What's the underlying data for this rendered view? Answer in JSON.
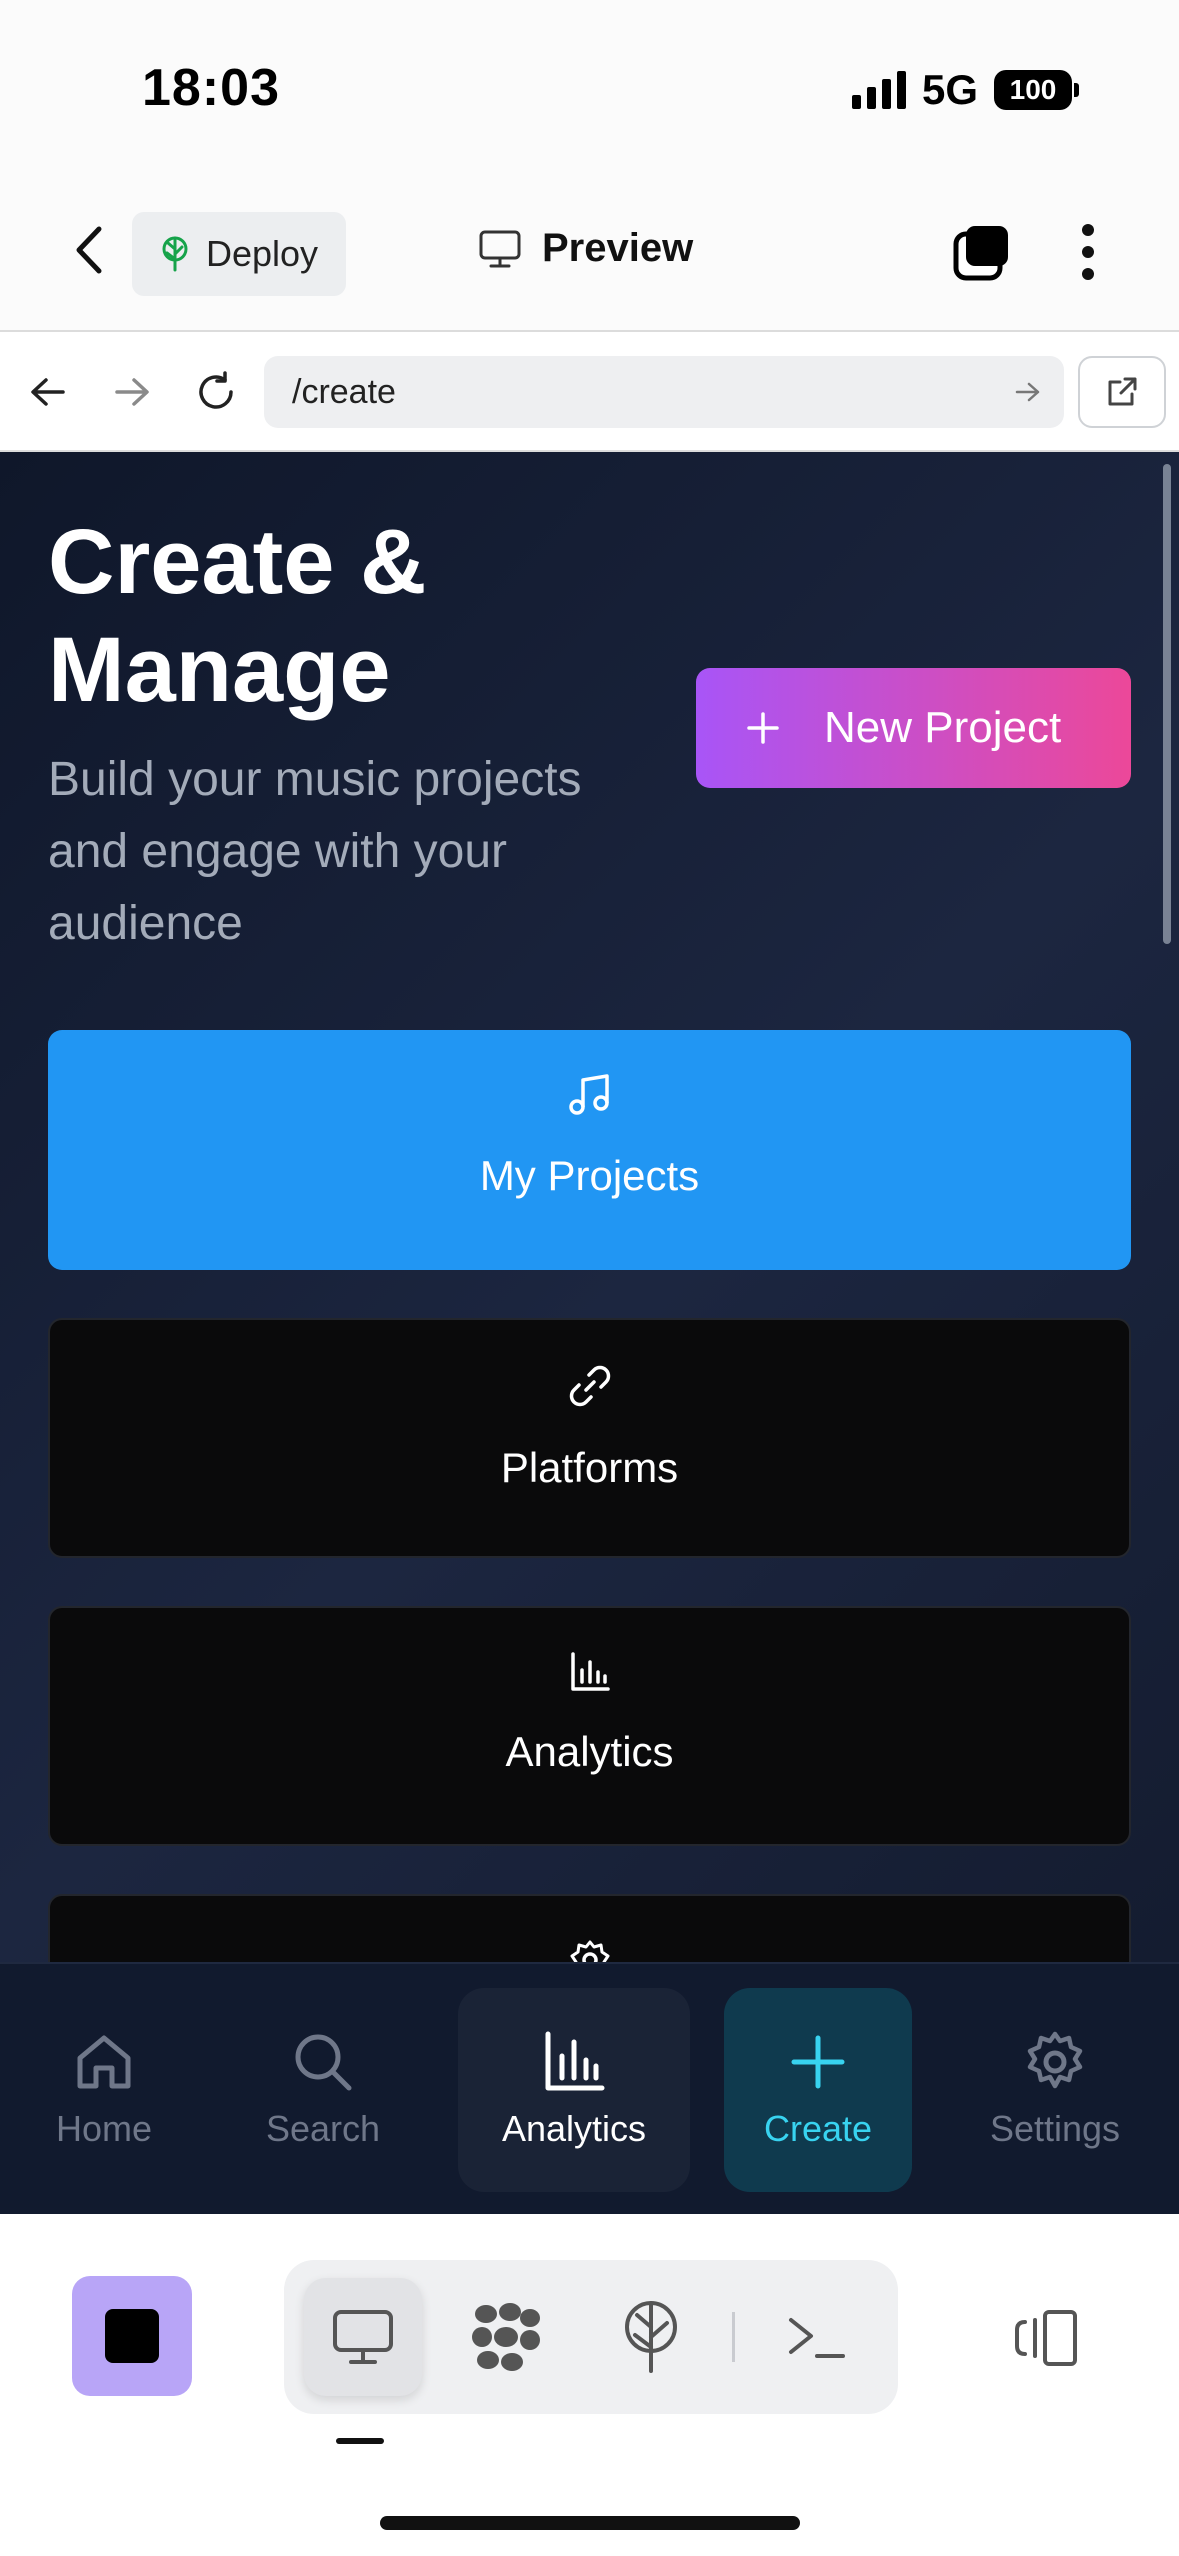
{
  "status_bar": {
    "time": "18:03",
    "network": "5G",
    "battery": "100"
  },
  "header": {
    "deploy_label": "Deploy",
    "preview_label": "Preview",
    "icons": {
      "back": "chevron-left-icon",
      "deploy": "tree-icon",
      "preview": "monitor-icon",
      "tabs": "tabs-icon",
      "more": "more-vertical-icon"
    }
  },
  "browser": {
    "url": "/create"
  },
  "main": {
    "title": "Create & Manage",
    "subtitle": "Build your music projects and engage with your audience",
    "new_project_label": "New Project",
    "cards": [
      {
        "label": "My Projects",
        "icon": "music-note-icon",
        "active": true
      },
      {
        "label": "Platforms",
        "icon": "link-icon",
        "active": false
      },
      {
        "label": "Analytics",
        "icon": "bar-chart-icon",
        "active": false
      }
    ]
  },
  "tab_bar": {
    "tabs": [
      {
        "label": "Home",
        "icon": "home-icon"
      },
      {
        "label": "Search",
        "icon": "search-icon"
      },
      {
        "label": "Analytics",
        "icon": "bar-chart-icon",
        "selected": true
      },
      {
        "label": "Create",
        "icon": "plus-icon",
        "highlighted": true
      },
      {
        "label": "Settings",
        "icon": "gear-icon"
      }
    ]
  },
  "colors": {
    "accent_blue": "#2196f3",
    "gradient_start": "#a855f7",
    "gradient_end": "#ec4899",
    "create_cyan": "#38d3f0",
    "stop_button": "#b8a5f7"
  }
}
